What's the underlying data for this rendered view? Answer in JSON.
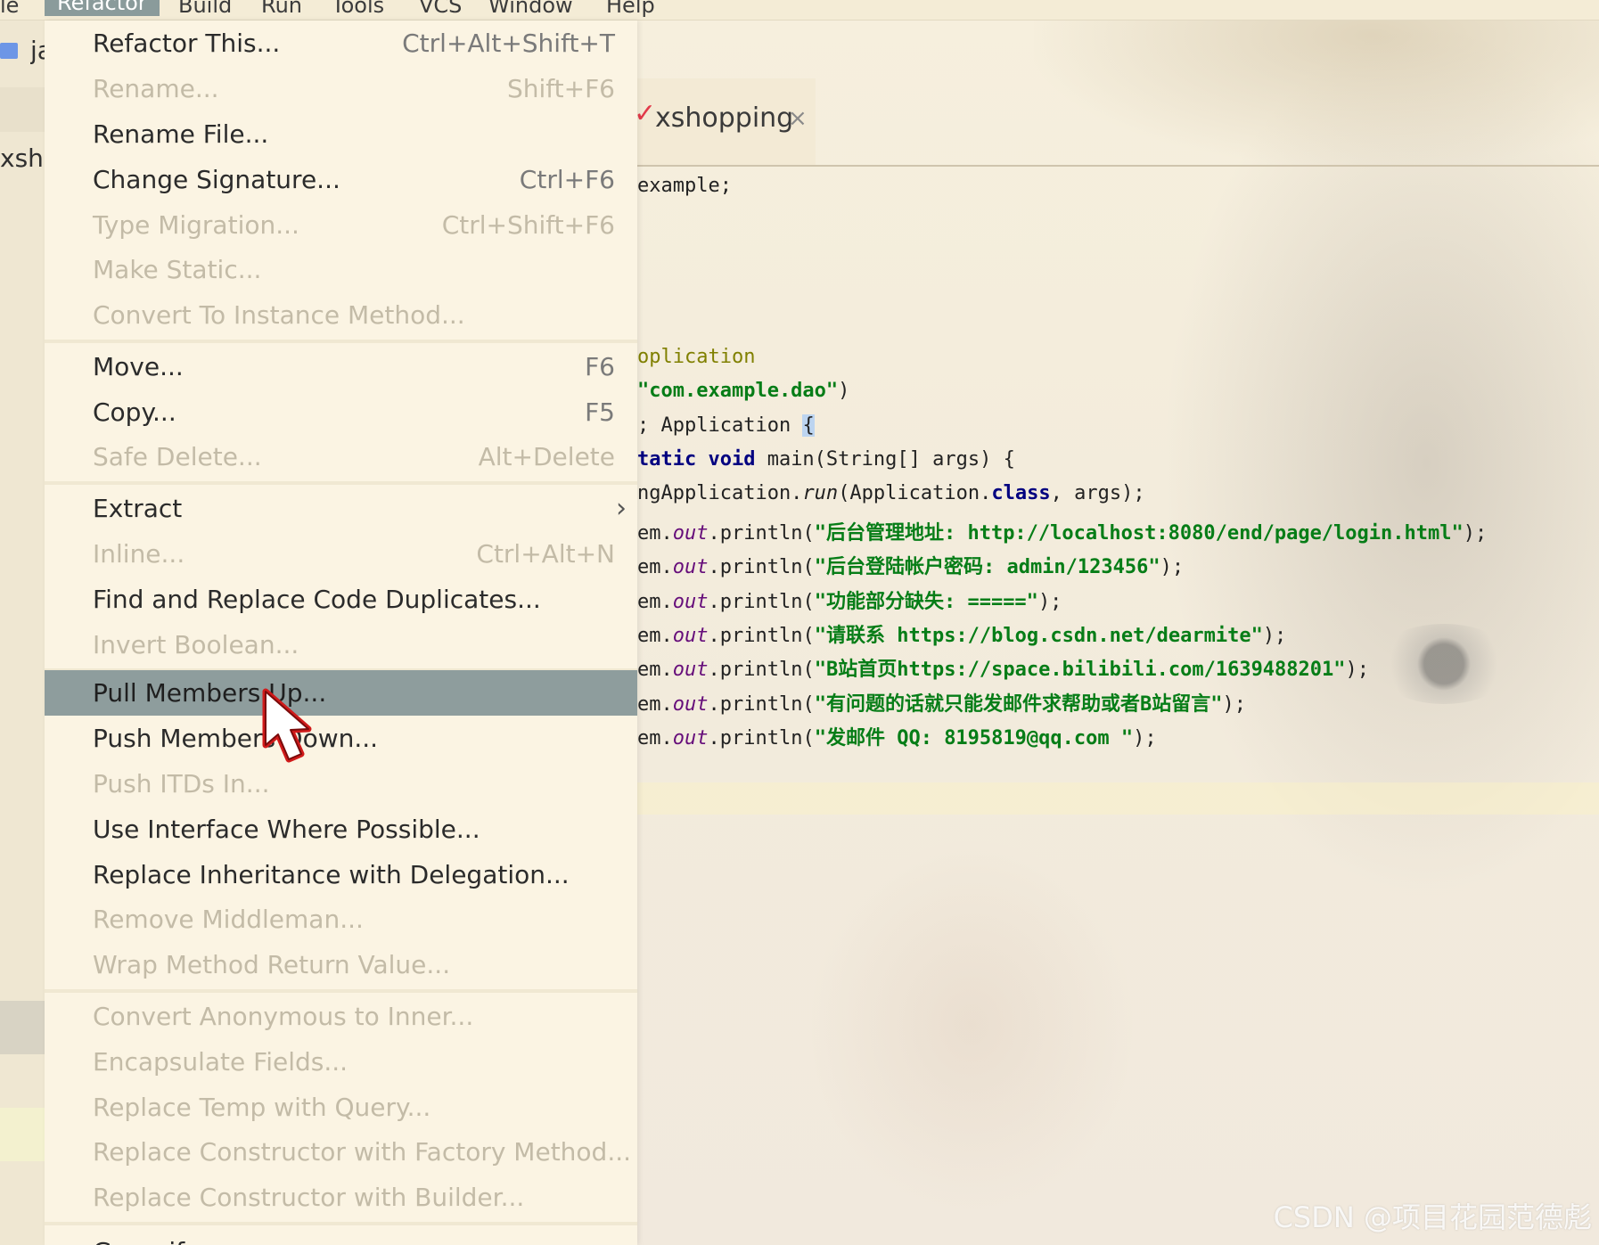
{
  "menubar": {
    "items": [
      {
        "label": "le"
      },
      {
        "label": "Refactor"
      },
      {
        "label": "Build"
      },
      {
        "label": "Run"
      },
      {
        "label": "Tools"
      },
      {
        "label": "VCS"
      },
      {
        "label": "Window"
      },
      {
        "label": "Help"
      }
    ]
  },
  "sidebar": {
    "project_short": "ja",
    "module_short": "xsh"
  },
  "editor_tab": {
    "label": "xshopping",
    "close": "×"
  },
  "code": {
    "l1": "example;",
    "l2": "oplication",
    "l3_str": "\"com.example.dao\"",
    "l3_end": ")",
    "l4_a": "; Application ",
    "l4_b": "{",
    "l5_kw": "tatic void",
    "l5_rest": " main(String[] args) {",
    "l6_a": "ngApplication.",
    "l6_run": "run",
    "l6_b": "(Application.",
    "l6_kw": "class",
    "l6_c": ", args);",
    "prefix": "em.",
    "out": "out",
    "println": ".println(",
    "s1": "\"后台管理地址: http://localhost:8080/end/page/login.html\"",
    "s2": "\"后台登陆帐户密码: admin/123456\"",
    "s3": "\"功能部分缺失: =====\"",
    "s4": "\"请联系 https://blog.csdn.net/dearmite\"",
    "s5": "\"B站首页https://space.bilibili.com/1639488201\"",
    "s6": "\"有问题的话就只能发邮件求帮助或者B站留言\"",
    "s7": "\"发邮件 QQ: 8195819@qq.com \"",
    "end": ");"
  },
  "menu": {
    "items": [
      {
        "label": "Refactor This...",
        "shortcut": "Ctrl+Alt+Shift+T"
      },
      {
        "label": "Rename...",
        "shortcut": "Shift+F6"
      },
      {
        "label": "Rename File...",
        "shortcut": ""
      },
      {
        "label": "Change Signature...",
        "shortcut": "Ctrl+F6"
      },
      {
        "label": "Type Migration...",
        "shortcut": "Ctrl+Shift+F6"
      },
      {
        "label": "Make Static...",
        "shortcut": ""
      },
      {
        "label": "Convert To Instance Method...",
        "shortcut": ""
      },
      {
        "label": "Move...",
        "shortcut": "F6"
      },
      {
        "label": "Copy...",
        "shortcut": "F5"
      },
      {
        "label": "Safe Delete...",
        "shortcut": "Alt+Delete"
      },
      {
        "label": "Extract",
        "shortcut": ""
      },
      {
        "label": "Inline...",
        "shortcut": "Ctrl+Alt+N"
      },
      {
        "label": "Find and Replace Code Duplicates...",
        "shortcut": ""
      },
      {
        "label": "Invert Boolean...",
        "shortcut": ""
      },
      {
        "label": "Pull Members Up...",
        "shortcut": ""
      },
      {
        "label": "Push Members Down...",
        "shortcut": ""
      },
      {
        "label": "Push ITDs In...",
        "shortcut": ""
      },
      {
        "label": "Use Interface Where Possible...",
        "shortcut": ""
      },
      {
        "label": "Replace Inheritance with Delegation...",
        "shortcut": ""
      },
      {
        "label": "Remove Middleman...",
        "shortcut": ""
      },
      {
        "label": "Wrap Method Return Value...",
        "shortcut": ""
      },
      {
        "label": "Convert Anonymous to Inner...",
        "shortcut": ""
      },
      {
        "label": "Encapsulate Fields...",
        "shortcut": ""
      },
      {
        "label": "Replace Temp with Query...",
        "shortcut": ""
      },
      {
        "label": "Replace Constructor with Factory Method...",
        "shortcut": ""
      },
      {
        "label": "Replace Constructor with Builder...",
        "shortcut": ""
      },
      {
        "label": "Generify...",
        "shortcut": ""
      }
    ],
    "submenu_arrow": "›"
  },
  "watermark": "CSDN @项目花园范德彪",
  "colors": {
    "menu_bg": "#fbf4e3",
    "selected_bg": "#8e9d9d",
    "disabled_text": "#c3bba7",
    "string": "#067d17",
    "keyword": "#000080"
  }
}
